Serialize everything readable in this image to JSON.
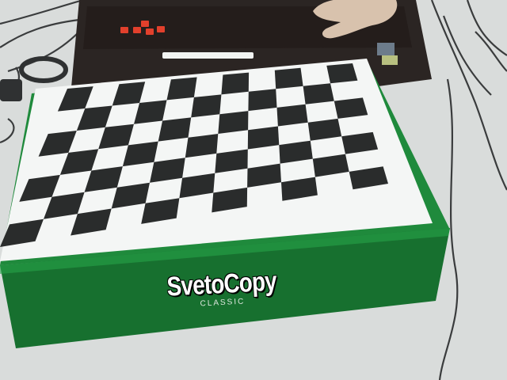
{
  "photo": {
    "box_brand": "SvetoCopy",
    "box_line": "CLASSIC",
    "checkerboard": {
      "columns": 11,
      "rows": 7
    },
    "colors": {
      "desk": "#d9dcdb",
      "box_green": "#1f8a3c",
      "box_green_dark": "#17702f",
      "paper": "#f4f6f5",
      "square": "#2a2c2c",
      "laptop": "#2b2523",
      "keyboard_glow": "#e2402c"
    }
  }
}
